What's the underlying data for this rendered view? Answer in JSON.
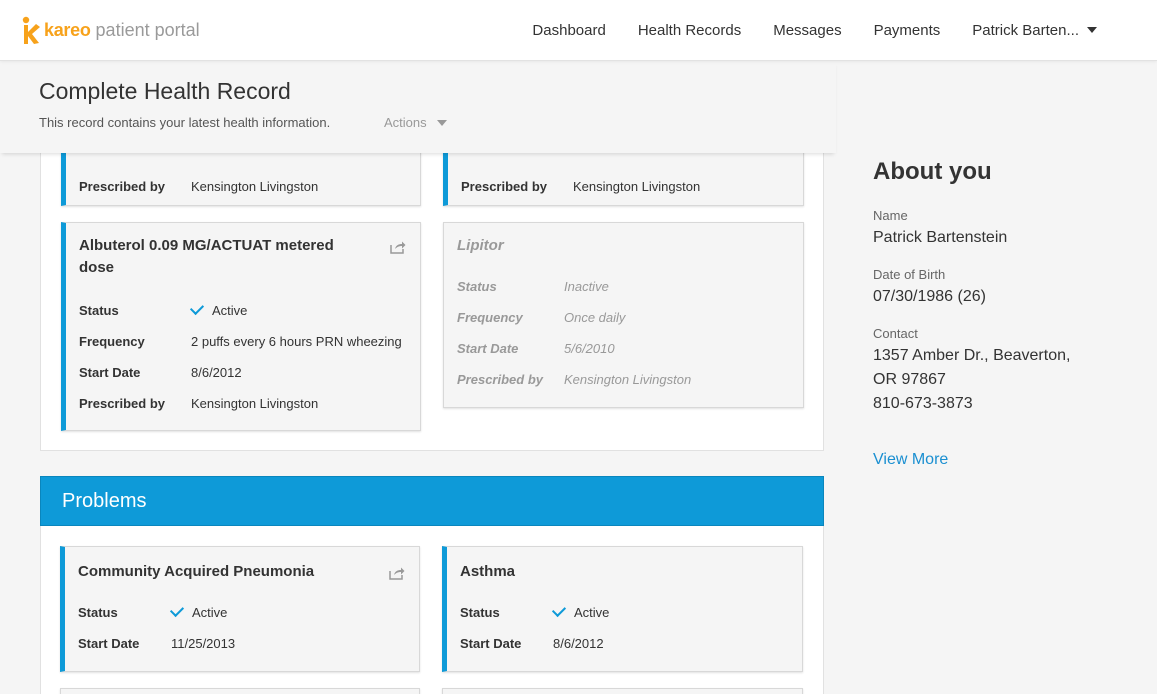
{
  "app": {
    "brand": "kareo",
    "brand_suffix": "patient portal",
    "brand_color": "#f7a21b"
  },
  "nav": {
    "items": [
      {
        "label": "Dashboard"
      },
      {
        "label": "Health Records"
      },
      {
        "label": "Messages"
      },
      {
        "label": "Payments"
      }
    ],
    "user": "Patrick Barten..."
  },
  "header": {
    "title": "Complete Health Record",
    "subtitle": "This record contains your latest health information.",
    "actions_label": "Actions"
  },
  "medications": {
    "top_left": {
      "prescribed_by_label": "Prescribed by",
      "prescribed_by": "Kensington Livingston"
    },
    "top_right": {
      "prescribed_by_label": "Prescribed by",
      "prescribed_by": "Kensington Livingston"
    },
    "albuterol": {
      "title": "Albuterol 0.09 MG/ACTUAT metered dose",
      "status_label": "Status",
      "status": "Active",
      "frequency_label": "Frequency",
      "frequency": "2 puffs every 6 hours PRN wheezing",
      "start_label": "Start Date",
      "start": "8/6/2012",
      "prescribed_by_label": "Prescribed by",
      "prescribed_by": "Kensington Livingston"
    },
    "lipitor": {
      "title": "Lipitor",
      "status_label": "Status",
      "status": "Inactive",
      "frequency_label": "Frequency",
      "frequency": "Once daily",
      "start_label": "Start Date",
      "start": "5/6/2010",
      "prescribed_by_label": "Prescribed by",
      "prescribed_by": "Kensington Livingston"
    }
  },
  "problems": {
    "title": "Problems",
    "items": [
      {
        "title": "Community Acquired Pneumonia",
        "status_label": "Status",
        "status": "Active",
        "start_label": "Start Date",
        "start": "11/25/2013"
      },
      {
        "title": "Asthma",
        "status_label": "Status",
        "status": "Active",
        "start_label": "Start Date",
        "start": "8/6/2012"
      }
    ]
  },
  "about": {
    "title": "About you",
    "name_label": "Name",
    "name": "Patrick Bartenstein",
    "dob_label": "Date of Birth",
    "dob": "07/30/1986 (26)",
    "contact_label": "Contact",
    "address_line1": "1357 Amber Dr., Beaverton,",
    "address_line2": "OR 97867",
    "phone": "810-673-3873",
    "view_more": "View More"
  },
  "colors": {
    "accent": "#0e9ad8",
    "link": "#1a8fd1",
    "background": "#f5f5f5"
  },
  "icons": [
    "check-icon",
    "share-icon",
    "caret-down-icon"
  ]
}
